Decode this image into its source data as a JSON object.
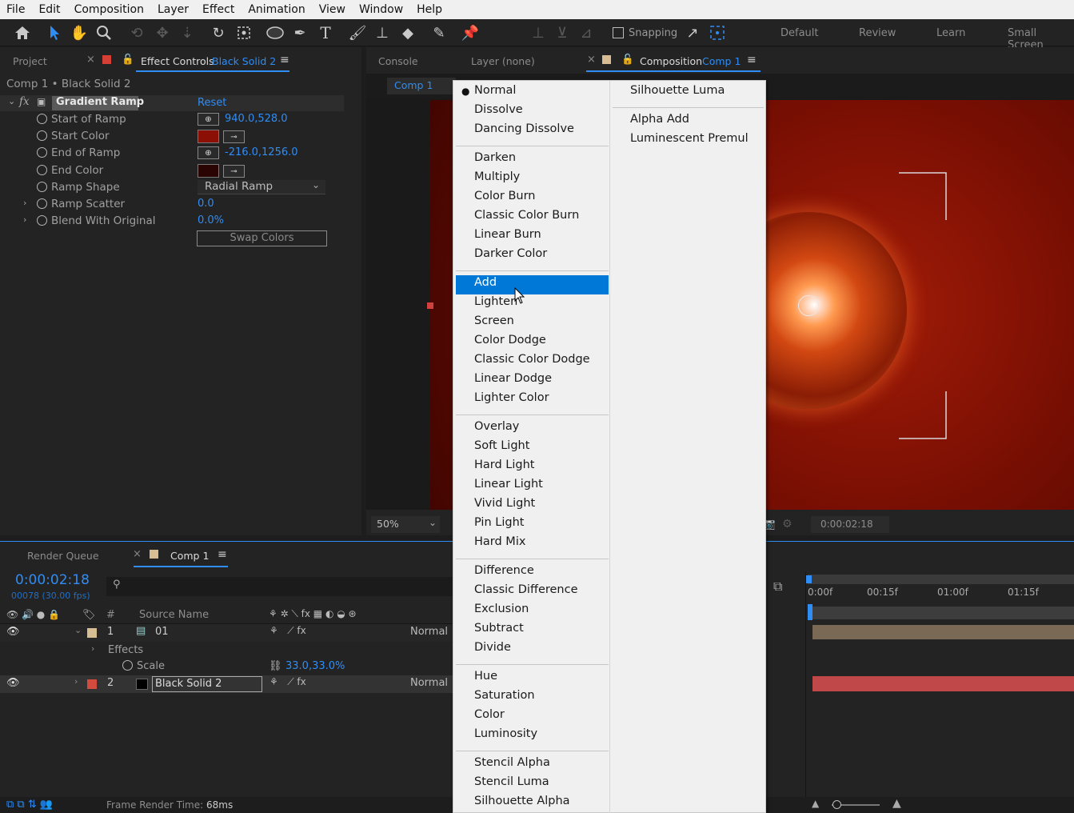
{
  "menubar": [
    "File",
    "Edit",
    "Composition",
    "Layer",
    "Effect",
    "Animation",
    "View",
    "Window",
    "Help"
  ],
  "toolbar": {
    "snapping_label": "Snapping",
    "workspaces": [
      "Default",
      "Review",
      "Learn",
      "Small Screen"
    ]
  },
  "effect_controls": {
    "project_tab": "Project",
    "tab_label": "Effect Controls",
    "tab_layer": "Black Solid 2",
    "header": "Comp 1 • Black Solid 2",
    "effect_name": "Gradient Ramp",
    "reset_label": "Reset",
    "props": [
      {
        "label": "Start of Ramp",
        "value": "940.0,528.0"
      },
      {
        "label": "Start Color",
        "color": "#8c0f06"
      },
      {
        "label": "End of Ramp",
        "value": "-216.0,1256.0"
      },
      {
        "label": "End Color",
        "color": "#2a0402"
      },
      {
        "label": "Ramp Shape",
        "value": "Radial Ramp"
      },
      {
        "label": "Ramp Scatter",
        "value": "0.0"
      },
      {
        "label": "Blend With Original",
        "value": "0.0%"
      }
    ],
    "swap_label": "Swap Colors"
  },
  "composition": {
    "console_tab": "Console",
    "layer_tab": "Layer (none)",
    "tab_label": "Composition",
    "tab_comp": "Comp 1",
    "breadcrumb": "Comp 1",
    "zoom": "50%",
    "timecode": "0:00:02:18"
  },
  "blend_menu": {
    "selected": "Normal",
    "highlighted": "Add",
    "col1": [
      [
        "Normal",
        "Dissolve",
        "Dancing Dissolve"
      ],
      [
        "Darken",
        "Multiply",
        "Color Burn",
        "Classic Color Burn",
        "Linear Burn",
        "Darker Color"
      ],
      [
        "Add",
        "Lighten",
        "Screen",
        "Color Dodge",
        "Classic Color Dodge",
        "Linear Dodge",
        "Lighter Color"
      ],
      [
        "Overlay",
        "Soft Light",
        "Hard Light",
        "Linear Light",
        "Vivid Light",
        "Pin Light",
        "Hard Mix"
      ],
      [
        "Difference",
        "Classic Difference",
        "Exclusion",
        "Subtract",
        "Divide"
      ],
      [
        "Hue",
        "Saturation",
        "Color",
        "Luminosity"
      ],
      [
        "Stencil Alpha",
        "Stencil Luma",
        "Silhouette Alpha"
      ]
    ],
    "col2": [
      [
        "Silhouette Luma"
      ],
      [
        "Alpha Add",
        "Luminescent Premul"
      ]
    ]
  },
  "timeline": {
    "render_queue_tab": "Render Queue",
    "comp_tab": "Comp 1",
    "timecode": "0:00:02:18",
    "frames": "00078 (30.00 fps)",
    "col_num": "#",
    "col_source": "Source Name",
    "layers": [
      {
        "num": "1",
        "name": "01",
        "mode": "Normal"
      },
      {
        "num": "2",
        "name": "Black Solid 2",
        "mode": "Normal"
      }
    ],
    "effects_label": "Effects",
    "scale_label": "Scale",
    "scale_value": "33.0,33.0%",
    "ruler": [
      "0:00f",
      "00:15f",
      "01:00f",
      "01:15f"
    ],
    "status": "Frame Render Time:",
    "status_value": "68ms"
  }
}
